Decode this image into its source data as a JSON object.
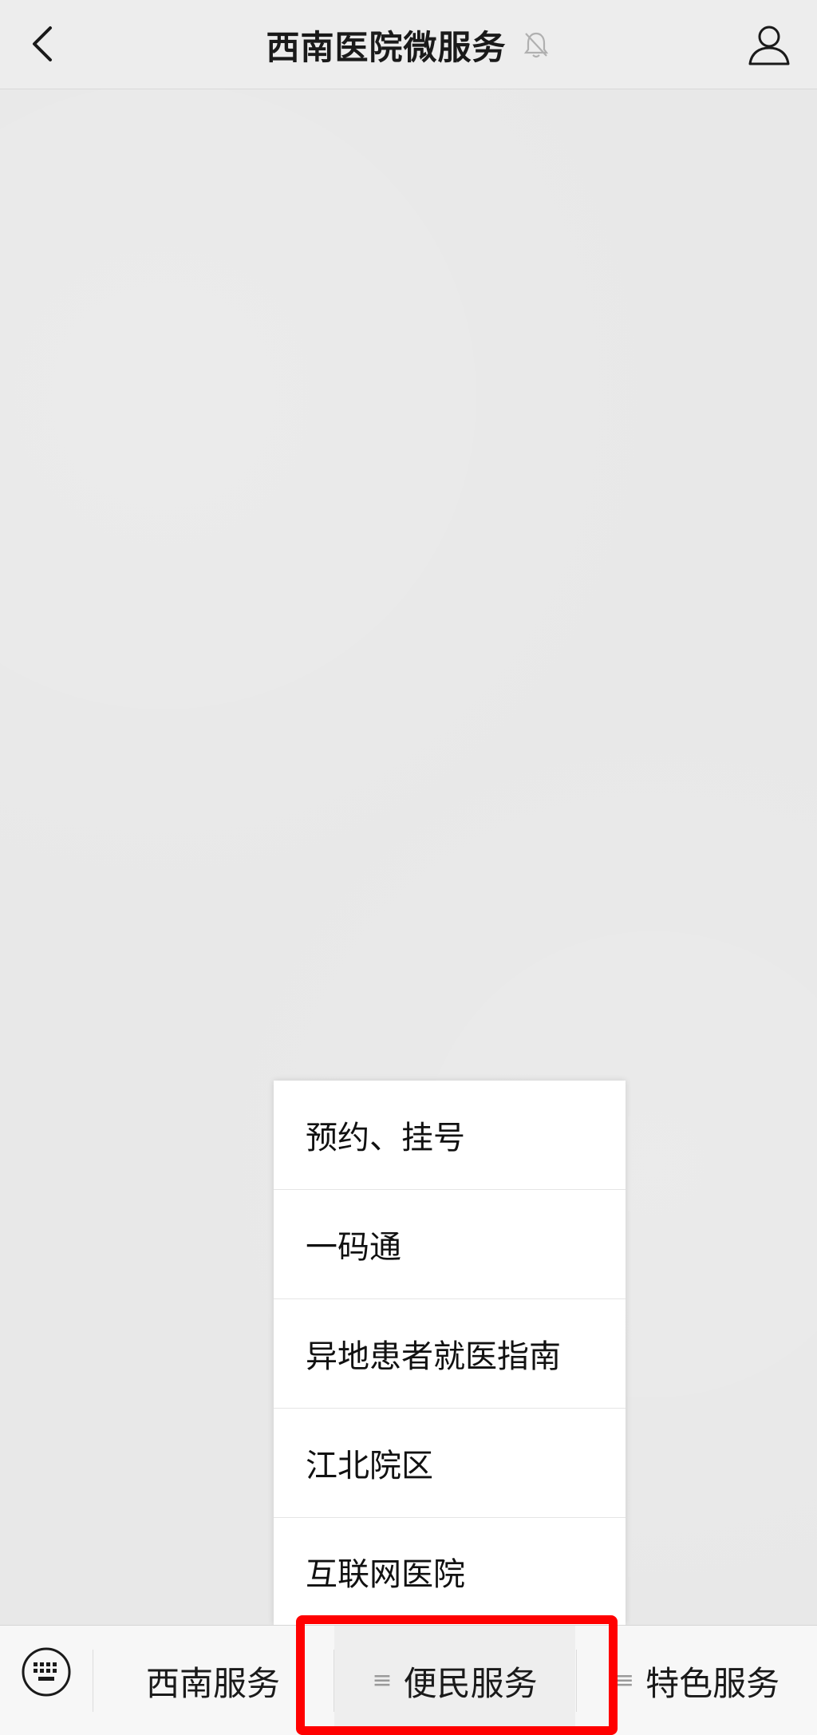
{
  "header": {
    "title": "西南医院微服务",
    "back_icon": "chevron-left-icon",
    "mute_icon": "bell-muted-icon",
    "profile_icon": "user-icon"
  },
  "submenu": {
    "items": [
      {
        "label": "预约、挂号"
      },
      {
        "label": "一码通"
      },
      {
        "label": "异地患者就医指南"
      },
      {
        "label": "江北院区"
      },
      {
        "label": "互联网医院"
      }
    ]
  },
  "bottom_menu": {
    "keyboard_icon": "keyboard-icon",
    "items": [
      {
        "label": "西南服务",
        "has_submenu": false
      },
      {
        "label": "便民服务",
        "has_submenu": true,
        "active": true
      },
      {
        "label": "特色服务",
        "has_submenu": true
      }
    ],
    "submenu_indicator": "≡"
  },
  "colors": {
    "highlight": "#ff0000",
    "top_bar_bg": "#ededed",
    "chat_bg": "#e8e8e8"
  }
}
